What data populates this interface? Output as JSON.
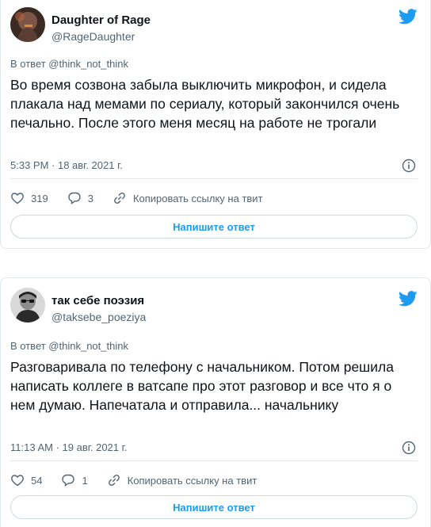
{
  "colors": {
    "accent": "#1d9bf0",
    "text": "#0f1419",
    "muted": "#536471",
    "border": "#e1e8ed"
  },
  "tweets": [
    {
      "author_name": "Daughter of Rage",
      "author_handle": "@RageDaughter",
      "reply_to": "В ответ @think_not_think",
      "text": "Во время созвона забыла выключить микрофон, и сидела плакала над мемами по сериалу, который закончился очень печально. После этого меня месяц на работе не трогали",
      "timestamp": "5:33 PM · 18 авг. 2021 г.",
      "likes": "319",
      "replies": "3",
      "copy_link_label": "Копировать ссылку на твит",
      "reply_button_label": "Напишите ответ",
      "icons": [
        "twitter-logo-icon",
        "info-icon",
        "heart-icon",
        "reply-icon",
        "link-icon"
      ]
    },
    {
      "author_name": "так себе поэзия",
      "author_handle": "@taksebe_poeziya",
      "reply_to": "В ответ @think_not_think",
      "text": "Разговаривала по телефону с начальником. Потом решила написать коллеге в ватсапе про этот разговор и все что я о нем думаю. Напечатала и отправила... начальнику",
      "timestamp": "11:13 AM · 19 авг. 2021 г.",
      "likes": "54",
      "replies": "1",
      "copy_link_label": "Копировать ссылку на твит",
      "reply_button_label": "Напишите ответ",
      "icons": [
        "twitter-logo-icon",
        "info-icon",
        "heart-icon",
        "reply-icon",
        "link-icon"
      ]
    }
  ]
}
